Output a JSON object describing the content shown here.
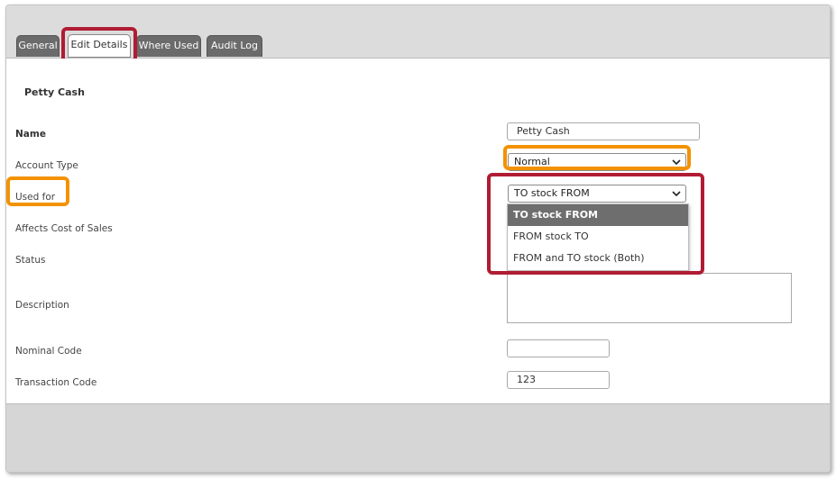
{
  "tabs": [
    {
      "label": "General"
    },
    {
      "label": "Edit Details"
    },
    {
      "label": "Where Used"
    },
    {
      "label": "Audit Log"
    }
  ],
  "section_title": "Petty Cash",
  "fields": {
    "name": {
      "label": "Name",
      "value": "Petty Cash"
    },
    "account_type": {
      "label": "Account Type",
      "value": "Normal"
    },
    "used_for": {
      "label": "Used for",
      "value": "TO stock FROM",
      "options": [
        "TO stock FROM",
        "FROM stock TO",
        "FROM and TO stock (Both)"
      ]
    },
    "affects_cost_of_sales": {
      "label": "Affects Cost of Sales"
    },
    "status": {
      "label": "Status"
    },
    "description": {
      "label": "Description",
      "value": ""
    },
    "nominal_code": {
      "label": "Nominal Code",
      "value": ""
    },
    "transaction_code": {
      "label": "Transaction Code",
      "value": "123"
    }
  },
  "colors": {
    "highlight_red": "#b01c33",
    "highlight_orange": "#f39200",
    "tab_inactive": "#6b6b6b",
    "dropdown_selected": "#6e6e6e"
  }
}
